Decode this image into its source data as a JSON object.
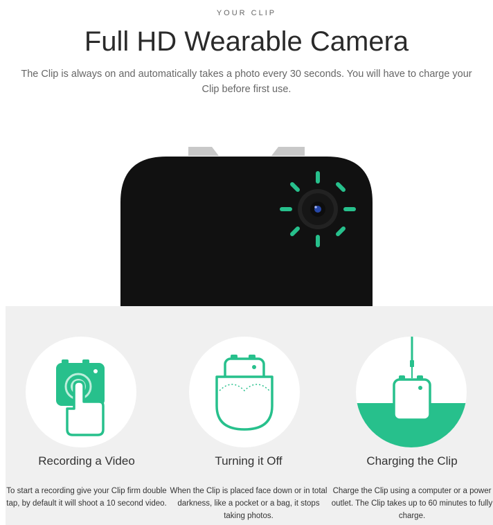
{
  "header": {
    "eyebrow": "YOUR CLIP",
    "title": "Full HD Wearable Camera",
    "subtitle": "The Clip is always on and automatically takes a photo every 30 seconds. You will have to charge your Clip before first use."
  },
  "colors": {
    "accent": "#27c08c",
    "camera_body": "#111111",
    "panel_bg": "#f0f0f0",
    "clip_tab": "#c8c8c8"
  },
  "features": [
    {
      "icon": "recording-icon",
      "title": "Recording a Video",
      "description": "To start a recording give your Clip firm double tap, by default it will shoot a 10 second video."
    },
    {
      "icon": "turn-off-icon",
      "title": "Turning it Off",
      "description": "When the Clip is placed face down or in total darkness, like a pocket or a bag, it stops taking photos."
    },
    {
      "icon": "charging-icon",
      "title": "Charging the Clip",
      "description": "Charge the Clip using a computer or a power outlet. The Clip takes up to 60 minutes to fully charge."
    }
  ]
}
